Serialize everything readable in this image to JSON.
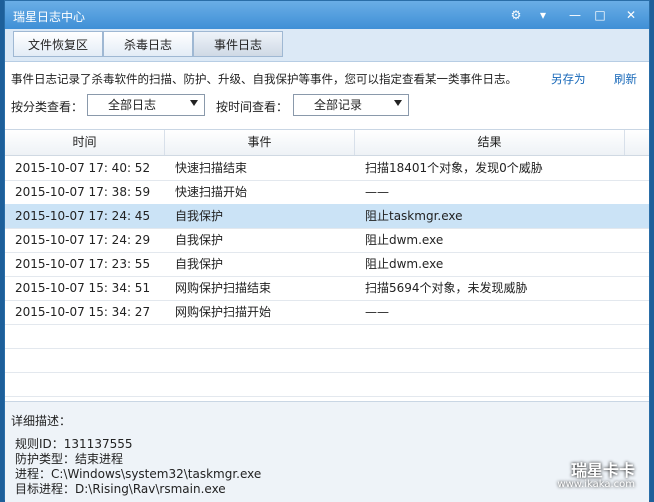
{
  "window": {
    "title": "瑞星日志中心",
    "controls": {
      "gear": "⚙",
      "menu": "▾",
      "minimize": "—",
      "maximize": "□",
      "close": "✕"
    }
  },
  "tabs": [
    {
      "label": "文件恢复区"
    },
    {
      "label": "杀毒日志"
    },
    {
      "label": "事件日志"
    }
  ],
  "description": "事件日志记录了杀毒软件的扫描、防护、升级、自我保护等事件，您可以指定查看某一类事件日志。",
  "actions": {
    "save_as": "另存为",
    "refresh": "刷新"
  },
  "filters": {
    "category_label": "按分类查看：",
    "category_value": "全部日志",
    "time_label": "按时间查看：",
    "time_value": "全部记录"
  },
  "table": {
    "columns": [
      "时间",
      "事件",
      "结果"
    ],
    "rows": [
      {
        "time": "2015-10-07 17: 40: 52",
        "event": "快速扫描结束",
        "result": "扫描18401个对象，发现0个威胁"
      },
      {
        "time": "2015-10-07 17: 38: 59",
        "event": "快速扫描开始",
        "result": "——"
      },
      {
        "time": "2015-10-07 17: 24: 45",
        "event": "自我保护",
        "result": "阻止taskmgr.exe"
      },
      {
        "time": "2015-10-07 17: 24: 29",
        "event": "自我保护",
        "result": "阻止dwm.exe"
      },
      {
        "time": "2015-10-07 17: 23: 55",
        "event": "自我保护",
        "result": "阻止dwm.exe"
      },
      {
        "time": "2015-10-07 15: 34: 51",
        "event": "网购保护扫描结束",
        "result": "扫描5694个对象，未发现威胁"
      },
      {
        "time": "2015-10-07 15: 34: 27",
        "event": "网购保护扫描开始",
        "result": "——"
      }
    ]
  },
  "detail": {
    "heading": "详细描述：",
    "lines": [
      "规则ID：131137555",
      "防护类型：结束进程",
      "进程：C:\\Windows\\system32\\taskmgr.exe",
      "目标进程：D:\\Rising\\Rav\\rsmain.exe"
    ]
  },
  "watermark": {
    "brand": "瑞星卡卡",
    "url": "www.ikaka.com"
  }
}
